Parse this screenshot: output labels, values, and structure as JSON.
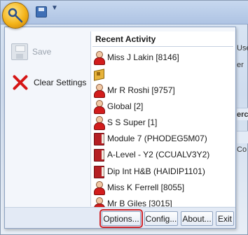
{
  "menu": {
    "left_items": [
      {
        "label": "Save",
        "icon": "disk-icon",
        "enabled": false
      },
      {
        "label": "Clear Settings",
        "icon": "close-icon",
        "enabled": true
      }
    ],
    "recent_activity": {
      "title": "Recent Activity",
      "items": [
        {
          "label": "Miss J Lakin [8146]",
          "icon": "person-icon"
        },
        {
          "label": "",
          "icon": "group-icon"
        },
        {
          "label": "Mr R Roshi [9757]",
          "icon": "person-icon"
        },
        {
          "label": "Global [2]",
          "icon": "person-icon"
        },
        {
          "label": "S S Super [1]",
          "icon": "person-icon"
        },
        {
          "label": "Module 7 (PHODEG5M07)",
          "icon": "book-icon"
        },
        {
          "label": "A-Level - Y2 (CCUALV3Y2)",
          "icon": "book-icon"
        },
        {
          "label": "Dip Int H&B (HAIDIP1101)",
          "icon": "book-icon"
        },
        {
          "label": "Miss K Ferrell [8055]",
          "icon": "person-icon"
        },
        {
          "label": "Mr B Giles [3015]",
          "icon": "person-icon"
        }
      ]
    },
    "footer_buttons": {
      "options": "Options...",
      "config": "Config...",
      "about": "About...",
      "exit": "Exit"
    }
  },
  "background_fragments": [
    "Use",
    "er",
    "erc",
    "Co"
  ],
  "colors": {
    "accent": "#d0262b",
    "person_red": "#d21c1c",
    "book_red": "#b51f24"
  }
}
